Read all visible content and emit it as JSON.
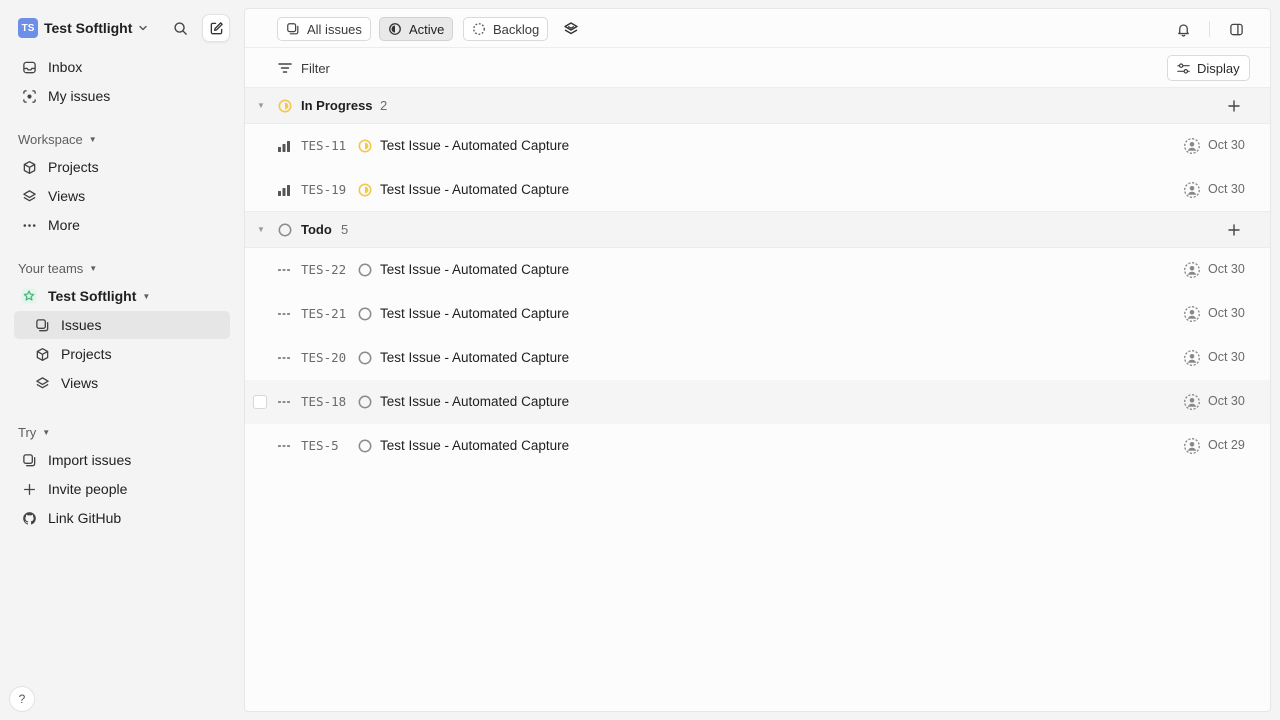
{
  "workspace": {
    "initials": "TS",
    "name": "Test Softlight"
  },
  "nav": {
    "inbox": "Inbox",
    "my_issues": "My issues",
    "workspace_label": "Workspace",
    "projects": "Projects",
    "views": "Views",
    "more": "More",
    "teams_label": "Your teams",
    "team_name": "Test Softlight",
    "team_issues": "Issues",
    "team_projects": "Projects",
    "team_views": "Views",
    "try_label": "Try",
    "import_issues": "Import issues",
    "invite_people": "Invite people",
    "link_github": "Link GitHub",
    "help": "?"
  },
  "toolbar": {
    "tabs": [
      "All issues",
      "Active",
      "Backlog"
    ],
    "active_tab": "Active",
    "filter": "Filter",
    "display": "Display"
  },
  "groups": [
    {
      "name": "In Progress",
      "count": "2",
      "status_color": "#f2c94c",
      "issues": [
        {
          "id": "TES-11",
          "title": "Test Issue - Automated Capture",
          "date": "Oct 30",
          "priority": "high"
        },
        {
          "id": "TES-19",
          "title": "Test Issue - Automated Capture",
          "date": "Oct 30",
          "priority": "high"
        }
      ]
    },
    {
      "name": "Todo",
      "count": "5",
      "status_color": "#8a8a8a",
      "issues": [
        {
          "id": "TES-22",
          "title": "Test Issue - Automated Capture",
          "date": "Oct 30",
          "priority": "none"
        },
        {
          "id": "TES-21",
          "title": "Test Issue - Automated Capture",
          "date": "Oct 30",
          "priority": "none"
        },
        {
          "id": "TES-20",
          "title": "Test Issue - Automated Capture",
          "date": "Oct 30",
          "priority": "none"
        },
        {
          "id": "TES-18",
          "title": "Test Issue - Automated Capture",
          "date": "Oct 30",
          "priority": "none"
        },
        {
          "id": "TES-5",
          "title": "Test Issue - Automated Capture",
          "date": "Oct 29",
          "priority": "none"
        }
      ]
    }
  ],
  "colors": {
    "accent_avatar": "#6d8fe8",
    "team_icon": "#4cb782",
    "in_progress": "#f2c94c"
  }
}
